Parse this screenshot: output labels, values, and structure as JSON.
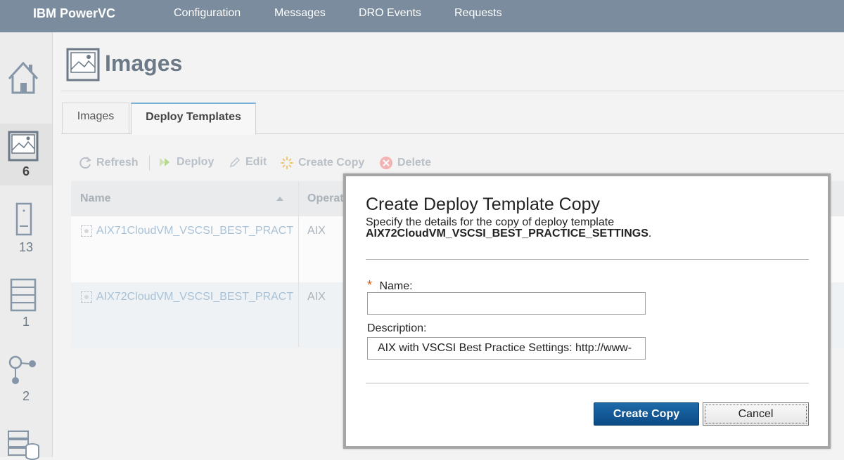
{
  "header": {
    "brand": "IBM PowerVC",
    "nav": [
      "Configuration",
      "Messages",
      "DRO Events",
      "Requests"
    ]
  },
  "sidebar": {
    "items": [
      {
        "icon": "home-icon",
        "count": ""
      },
      {
        "icon": "image-icon",
        "count": "6"
      },
      {
        "icon": "server-icon",
        "count": "13"
      },
      {
        "icon": "rack-icon",
        "count": "1"
      },
      {
        "icon": "network-icon",
        "count": "2"
      },
      {
        "icon": "storage-icon",
        "count": ""
      }
    ]
  },
  "page": {
    "title": "Images",
    "tabs": [
      {
        "label": "Images",
        "active": false
      },
      {
        "label": "Deploy Templates",
        "active": true
      }
    ]
  },
  "toolbar": {
    "refresh": "Refresh",
    "deploy": "Deploy",
    "edit": "Edit",
    "create_copy": "Create Copy",
    "delete": "Delete"
  },
  "grid": {
    "columns": [
      "Name",
      "Operat"
    ],
    "rows": [
      {
        "name": "AIX71CloudVM_VSCSI_BEST_PRACT",
        "os": "AIX"
      },
      {
        "name": "AIX72CloudVM_VSCSI_BEST_PRACT",
        "os": "AIX"
      }
    ]
  },
  "modal": {
    "title": "Create Deploy Template Copy",
    "desc_line1": "Specify the details for the copy of deploy template",
    "desc_template": "AIX72CloudVM_VSCSI_BEST_PRACTICE_SETTINGS",
    "desc_period": ".",
    "required_mark": "*",
    "name_label": "Name:",
    "name_value": "",
    "description_label": "Description:",
    "description_value": "AIX with VSCSI Best Practice Settings: http://www-",
    "create_button": "Create Copy",
    "cancel_button": "Cancel"
  },
  "colors": {
    "topbar": "#7a8c9e",
    "primary_button": "#0b4b86",
    "required": "#d05b0f"
  }
}
